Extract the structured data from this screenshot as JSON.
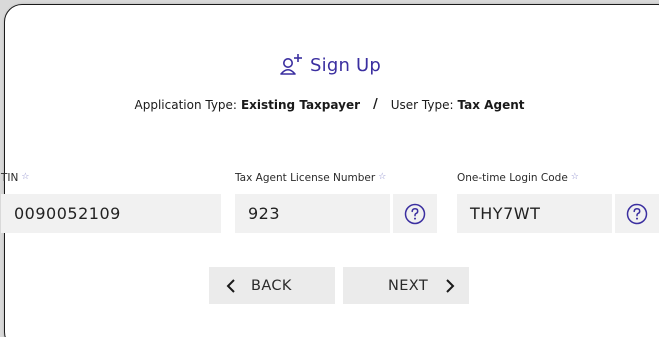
{
  "header": {
    "title": "Sign Up",
    "application_type_label": "Application Type:",
    "application_type_value": "Existing Taxpayer",
    "separator": "/",
    "user_type_label": "User Type:",
    "user_type_value": "Tax Agent"
  },
  "fields": {
    "tin": {
      "label": "TIN",
      "required_mark": "☆",
      "value": "0090052109"
    },
    "license": {
      "label": "Tax Agent License Number",
      "required_mark": "☆",
      "value": "923"
    },
    "login_code": {
      "label": "One-time Login Code",
      "required_mark": "☆",
      "value": "THY7WT"
    }
  },
  "buttons": {
    "back_label": "BACK",
    "next_label": "NEXT"
  },
  "colors": {
    "accent": "#3b2fa0",
    "field_bg": "#f1f1f1",
    "button_bg": "#ebebeb",
    "required_mark": "#8c8ccc"
  },
  "icons": {
    "title": "add-user-icon",
    "help": "question-circle-icon",
    "back": "chevron-left-icon",
    "next": "chevron-right-icon"
  }
}
